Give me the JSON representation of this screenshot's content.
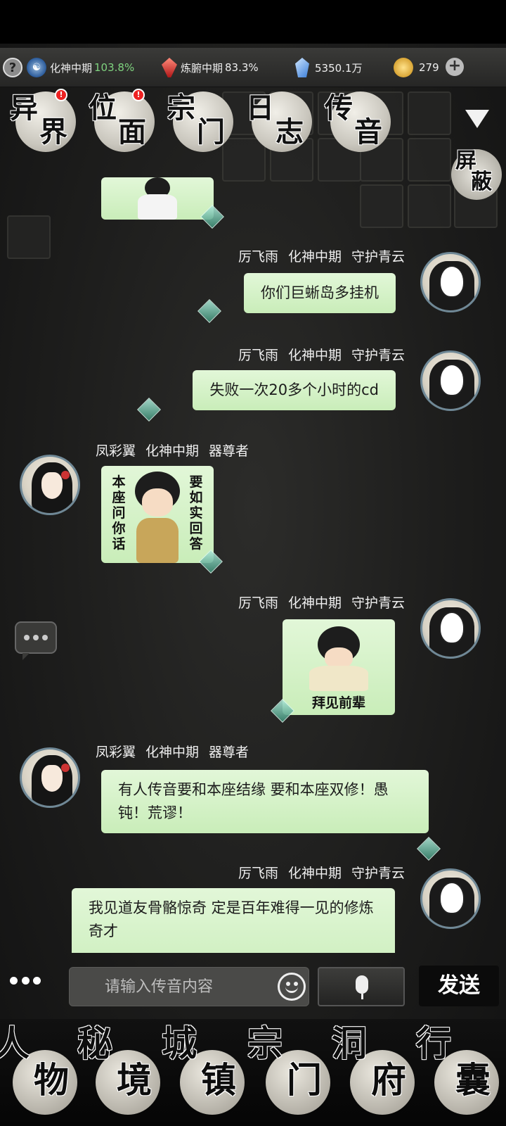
{
  "status": {
    "help_icon": "?",
    "realm1": {
      "label": "化神中期",
      "pct": "103.8%",
      "pct_color": "#7fd37f"
    },
    "realm2": {
      "label": "炼腑中期",
      "pct": "83.3%"
    },
    "spirit_stones": "5350.1万",
    "coins": "279",
    "add_icon": "+"
  },
  "top_nav": [
    {
      "c1": "异",
      "c2": "界",
      "badge": "!"
    },
    {
      "c1": "位",
      "c2": "面",
      "badge": "!"
    },
    {
      "c1": "宗",
      "c2": "门"
    },
    {
      "c1": "日",
      "c2": "志"
    },
    {
      "c1": "传",
      "c2": "音"
    }
  ],
  "block_button": {
    "c1": "屏",
    "c2": "蔽"
  },
  "chat": {
    "messages": [
      {
        "side": "right",
        "name": "厉飞雨",
        "realm": "化神中期",
        "title": "守护青云",
        "text": "你们巨蜥岛多挂机"
      },
      {
        "side": "right",
        "name": "厉飞雨",
        "realm": "化神中期",
        "title": "守护青云",
        "text": "失败一次20多个小时的cd"
      },
      {
        "side": "left",
        "name": "凤彩翼",
        "realm": "化神中期",
        "title": "器尊者",
        "sticker": {
          "left_col": "本座问你话",
          "right_col": "要如实回答"
        }
      },
      {
        "side": "right",
        "name": "厉飞雨",
        "realm": "化神中期",
        "title": "守护青云",
        "sticker": {
          "caption": "拜见前辈"
        }
      },
      {
        "side": "left",
        "name": "凤彩翼",
        "realm": "化神中期",
        "title": "器尊者",
        "text": "有人传音要和本座结缘 要和本座双修！愚钝！荒谬！"
      },
      {
        "side": "right",
        "name": "厉飞雨",
        "realm": "化神中期",
        "title": "守护青云",
        "text": "我见道友骨骼惊奇 定是百年难得一见的修炼奇才"
      }
    ]
  },
  "input": {
    "placeholder": "请输入传音内容",
    "send_label": "发送"
  },
  "bottom_nav": [
    {
      "c1": "人",
      "c2": "物"
    },
    {
      "c1": "秘",
      "c2": "境"
    },
    {
      "c1": "城",
      "c2": "镇"
    },
    {
      "c1": "宗",
      "c2": "门"
    },
    {
      "c1": "洞",
      "c2": "府"
    },
    {
      "c1": "行",
      "c2": "囊"
    }
  ]
}
